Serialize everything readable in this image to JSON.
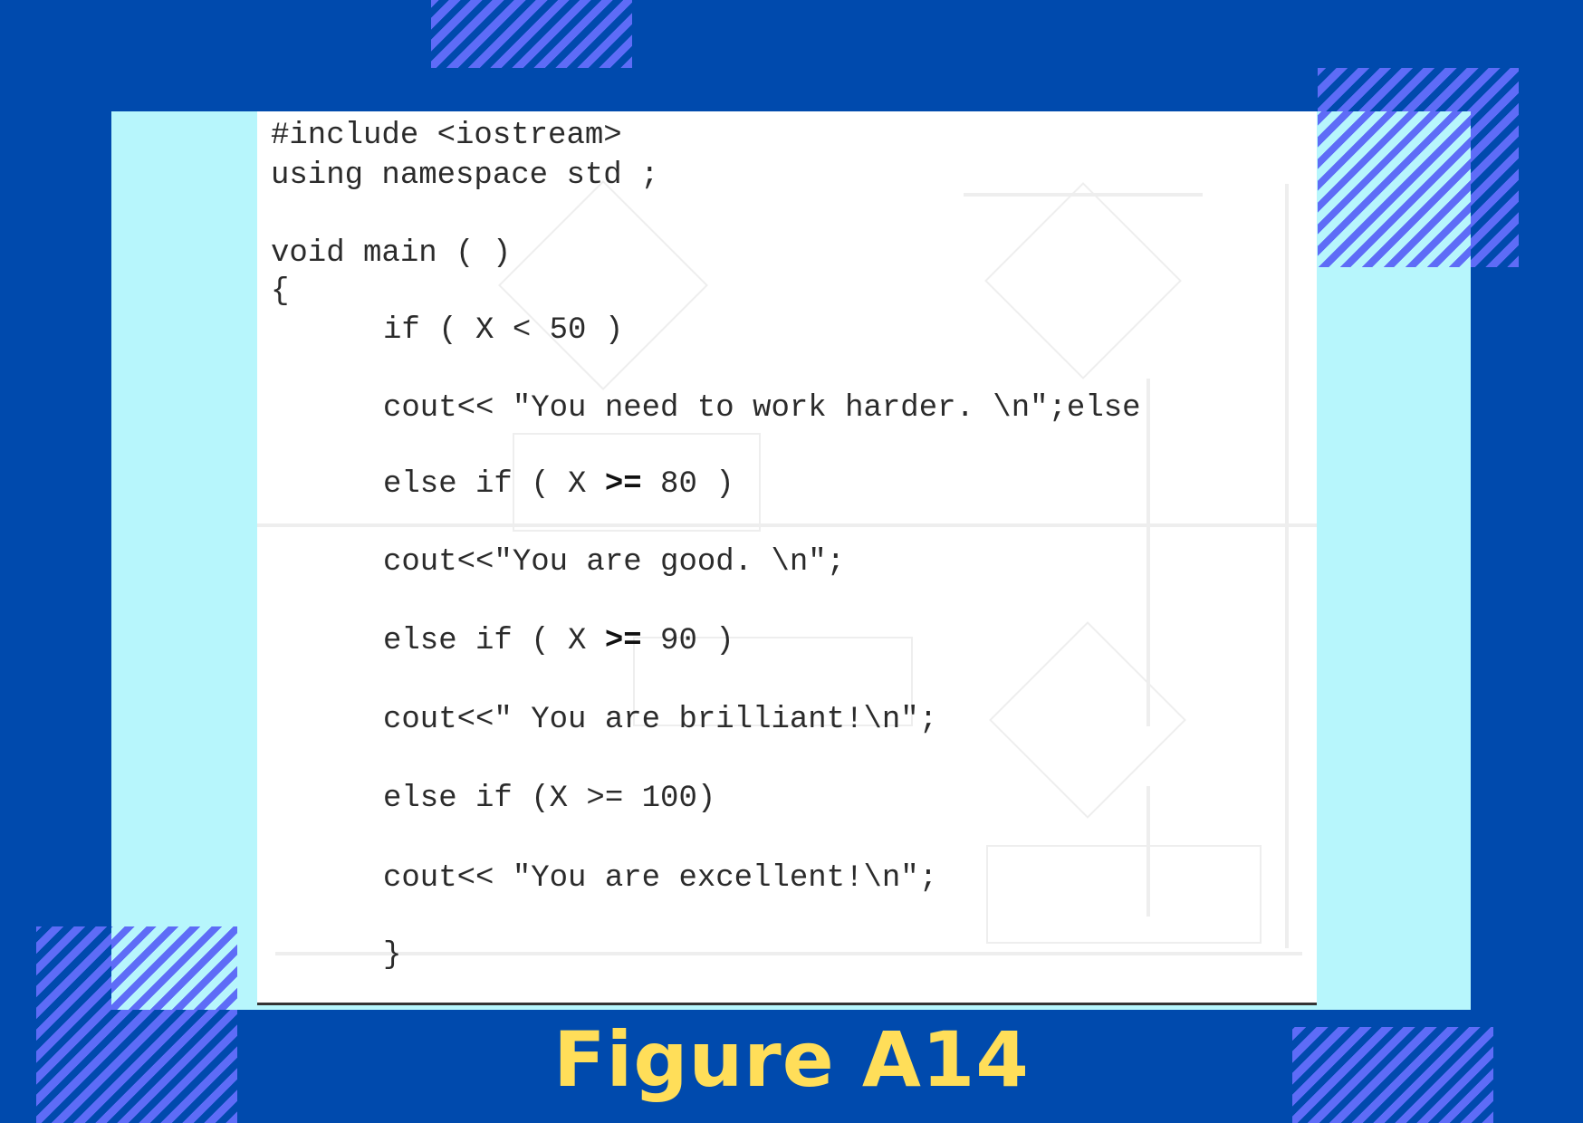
{
  "caption": "Figure A14",
  "colors": {
    "background": "#004aad",
    "panel": "#b7f6fc",
    "paper": "#ffffff",
    "stripe": "#5e6cf7",
    "caption": "#ffde59",
    "code_text": "#2b2b2b"
  },
  "code": {
    "line1": "#include <iostream>",
    "line2": "using namespace std ;",
    "line3": "void main ( )",
    "line4": "{",
    "line5": "if ( X < 50 )",
    "line6": "cout<< \"You need to work harder. \\n\";else",
    "line7_pre": "else if ( X ",
    "line7_op": ">=",
    "line7_post": " 80 )",
    "line8": "cout<<\"You are good. \\n\";",
    "line9_pre": "else if ( X ",
    "line9_op": ">=",
    "line9_post": " 90 )",
    "line10": "cout<<\" You are brilliant!\\n\";",
    "line11": "else if (X >= 100)",
    "line12": "cout<< \"You are excellent!\\n\";",
    "line13": "}"
  }
}
